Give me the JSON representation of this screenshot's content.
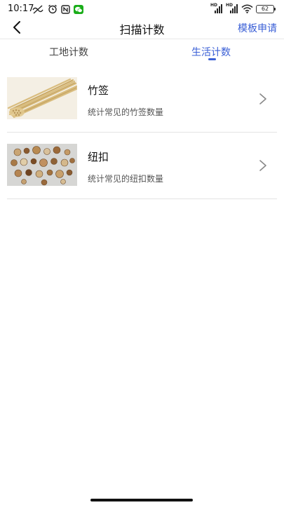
{
  "status_bar": {
    "time": "10:17",
    "battery_level": "62",
    "left_icons": [
      "no-disturb-icon",
      "alarm-icon",
      "nfc-icon",
      "wechat-icon"
    ],
    "right_icons": [
      "hd-signal-icon",
      "hd-signal-icon",
      "wifi-icon",
      "battery-icon"
    ],
    "hd_label": "HD"
  },
  "nav": {
    "title": "扫描计数",
    "action_label": "模板申请",
    "back_icon": "chevron-left-icon"
  },
  "tabs": [
    {
      "label": "工地计数",
      "active": false
    },
    {
      "label": "生活计数",
      "active": true
    }
  ],
  "colors": {
    "accent": "#3a5fd6",
    "divider": "#e4e4e4",
    "text_primary": "#111111",
    "text_secondary": "#555555",
    "wechat": "#1aad19"
  },
  "items": [
    {
      "title": "竹签",
      "description": "统计常见的竹签数量",
      "image": "bamboo-sticks-image",
      "icon": "chevron-right-icon"
    },
    {
      "title": "纽扣",
      "description": "统计常见的纽扣数量",
      "image": "buttons-image",
      "icon": "chevron-right-icon"
    }
  ]
}
